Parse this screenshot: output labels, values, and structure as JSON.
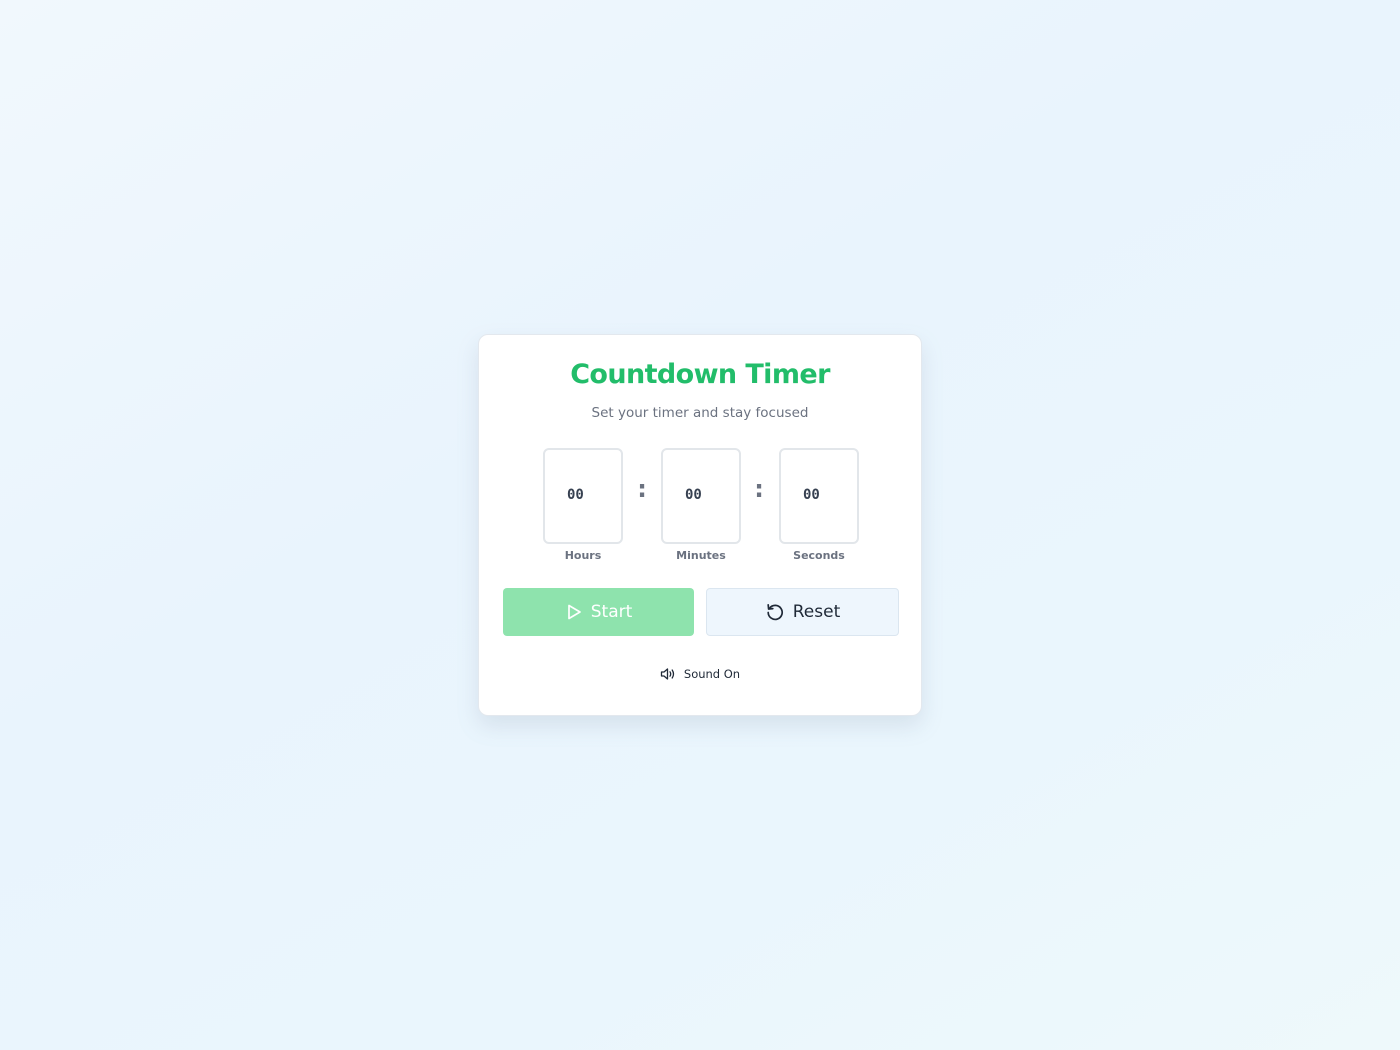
{
  "app": {
    "title": "Countdown Timer",
    "subtitle": "Set your timer and stay focused"
  },
  "timer": {
    "hours": {
      "value": "00",
      "label": "Hours"
    },
    "minutes": {
      "value": "00",
      "label": "Minutes"
    },
    "seconds": {
      "value": "00",
      "label": "Seconds"
    },
    "separator": ":"
  },
  "controls": {
    "start_label": "Start",
    "reset_label": "Reset",
    "start_icon": "play-icon",
    "reset_icon": "reset-icon"
  },
  "sound": {
    "label": "Sound On",
    "icon": "speaker-icon"
  },
  "colors": {
    "accent": "#22bd6a",
    "start_button": "#8ee3ad",
    "reset_button": "#eef6fd"
  }
}
